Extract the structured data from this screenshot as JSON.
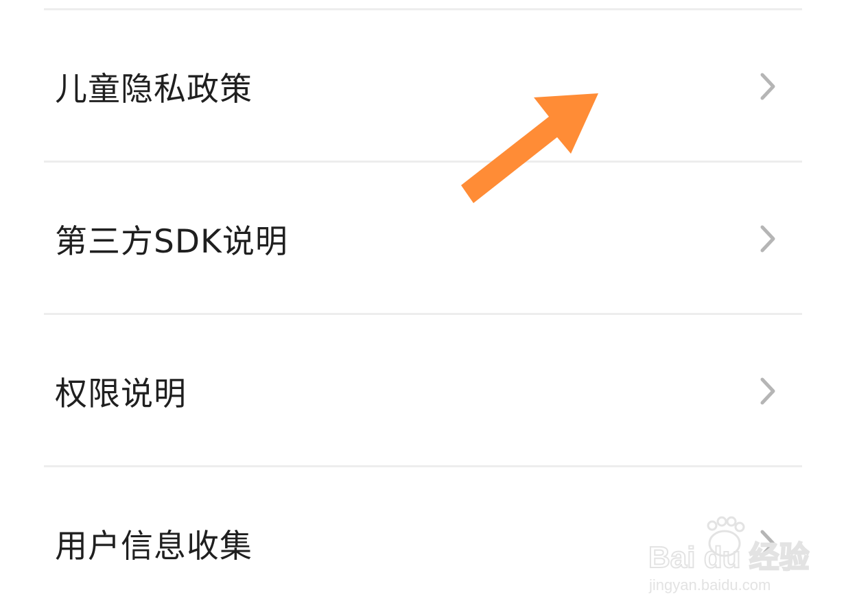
{
  "settings_list": {
    "items": [
      {
        "label": "儿童隐私政策",
        "icon": "chevron-right-icon"
      },
      {
        "label": "第三方SDK说明",
        "icon": "chevron-right-icon"
      },
      {
        "label": "权限说明",
        "icon": "chevron-right-icon"
      },
      {
        "label": "用户信息收集",
        "icon": "chevron-right-icon"
      }
    ]
  },
  "annotation": {
    "icon": "arrow-annotation-icon",
    "color": "#FF8C36"
  },
  "watermark": {
    "brand": "Bai du 经验",
    "url": "jingyan.baidu.com",
    "icon": "paw-icon"
  },
  "colors": {
    "text": "#1f1f1f",
    "divider": "#ededed",
    "chevron": "#b5b5b5"
  }
}
